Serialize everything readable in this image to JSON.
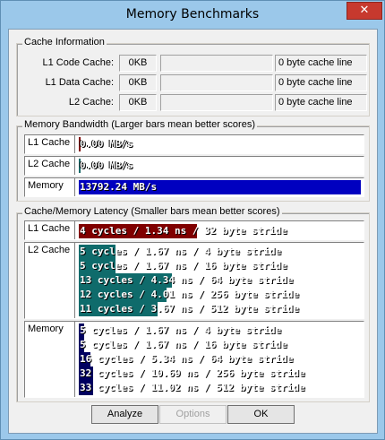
{
  "window": {
    "title": "Memory Benchmarks",
    "close_glyph": "✕"
  },
  "cache_info": {
    "legend": "Cache Information",
    "rows": [
      {
        "label": "L1 Code Cache:",
        "size": "0KB",
        "extra": "",
        "line": "0 byte cache line"
      },
      {
        "label": "L1 Data Cache:",
        "size": "0KB",
        "extra": "",
        "line": "0 byte cache line"
      },
      {
        "label": "L2 Cache:",
        "size": "0KB",
        "extra": "",
        "line": "0 byte cache line"
      }
    ]
  },
  "bandwidth": {
    "legend": "Memory Bandwidth (Larger bars mean better scores)",
    "rows": [
      {
        "name": "L1 Cache",
        "text": "0.00 MB/s",
        "fraction": 0.0,
        "color": "#800000"
      },
      {
        "name": "L2 Cache",
        "text": "0.00 MB/s",
        "fraction": 0.0,
        "color": "#1a6b6b"
      },
      {
        "name": "Memory",
        "text": "13792.24 MB/s",
        "fraction": 1.0,
        "color": "#0000c0"
      }
    ]
  },
  "latency": {
    "legend": "Cache/Memory Latency (Smaller bars mean better scores)",
    "groups": [
      {
        "name": "L1 Cache",
        "color": "#800000",
        "rows": [
          {
            "text": "4 cycles / 1.34 ns / 32 byte stride",
            "fraction": 0.42
          }
        ]
      },
      {
        "name": "L2 Cache",
        "color": "#0f6b6b",
        "rows": [
          {
            "text": "5 cycles / 1.67 ns / 4 byte stride",
            "fraction": 0.13
          },
          {
            "text": "5 cycles / 1.67 ns / 16 byte stride",
            "fraction": 0.13
          },
          {
            "text": "13 cycles / 4.34 ns / 64 byte stride",
            "fraction": 0.33
          },
          {
            "text": "12 cycles / 4.01 ns / 256 byte stride",
            "fraction": 0.31
          },
          {
            "text": "11 cycles / 3.67 ns / 512 byte stride",
            "fraction": 0.28
          }
        ]
      },
      {
        "name": "Memory",
        "color": "#000060",
        "rows": [
          {
            "text": "5 cycles / 1.67 ns / 4 byte stride",
            "fraction": 0.02
          },
          {
            "text": "5 cycles / 1.67 ns / 16 byte stride",
            "fraction": 0.02
          },
          {
            "text": "16 cycles / 5.34 ns / 64 byte stride",
            "fraction": 0.04
          },
          {
            "text": "32 cycles / 10.69 ns / 256 byte stride",
            "fraction": 0.05
          },
          {
            "text": "33 cycles / 11.02 ns / 512 byte stride",
            "fraction": 0.05
          }
        ]
      }
    ]
  },
  "buttons": {
    "analyze": "Analyze",
    "options": "Options",
    "ok": "OK"
  }
}
